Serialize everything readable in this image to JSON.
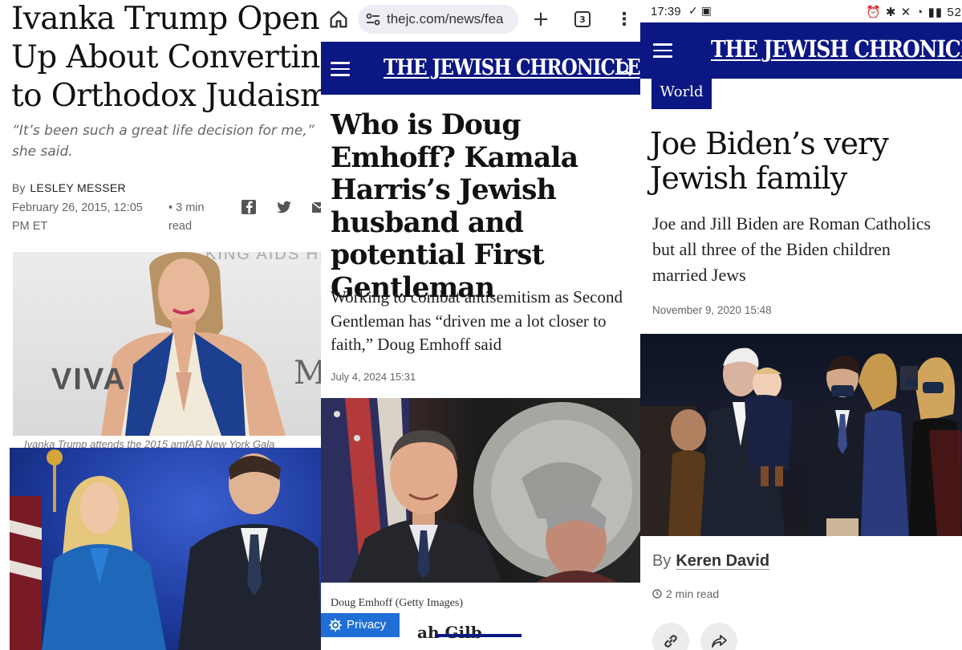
{
  "panel1": {
    "headline": [
      "Ivanka Trump Opens",
      "Up About Converting",
      "to Orthodox Judaism"
    ],
    "dek": "“It’s been such a great life decision for me,” she said.",
    "by_prefix": "By",
    "author": "LESLEY MESSER",
    "date": "February 26, 2015, 12:05 PM ET",
    "read_time": "• 3 min read",
    "social": [
      "facebook-icon",
      "twitter-icon",
      "email-icon"
    ],
    "photo1_banner_text": "KING AIDS HIS",
    "photo1_logo_text": "VIVA",
    "photo1_logo_text2": "M",
    "photo1_caption": "Ivanka Trump attends the 2015 amfAR New York Gala"
  },
  "panel2": {
    "url": "thejc.com/news/fea",
    "tab_count": "3",
    "masthead": "THE JEWISH CHRONICLE",
    "title": "Who is Doug Emhoff? Kamala Harris’s Jewish husband and potential First Gentleman",
    "dek": "Working to combat antisemitism as Second Gentleman has “driven me a lot closer to faith,” Doug Emhoff said",
    "date": "July 4, 2024 15:31",
    "caption": "Doug Emhoff (Getty Images)",
    "privacy_label": "Privacy",
    "cutoff_text": "ah Gilb"
  },
  "panel3": {
    "status_time": "17:39",
    "status_right": "52",
    "masthead": "THE JEWISH CHRONICLE",
    "tag": "World",
    "title": "Joe Biden’s very Jewish family",
    "dek": [
      "Joe and Jill Biden are Roman Catholics",
      "but all three of the Biden children",
      "married Jews"
    ],
    "date": "November 9, 2020 15:48",
    "by_prefix": "By",
    "author": "Keren David",
    "read_time": "2 min read"
  },
  "colors": {
    "navy": "#0b1783",
    "privacy_blue": "#1f6fd6"
  }
}
